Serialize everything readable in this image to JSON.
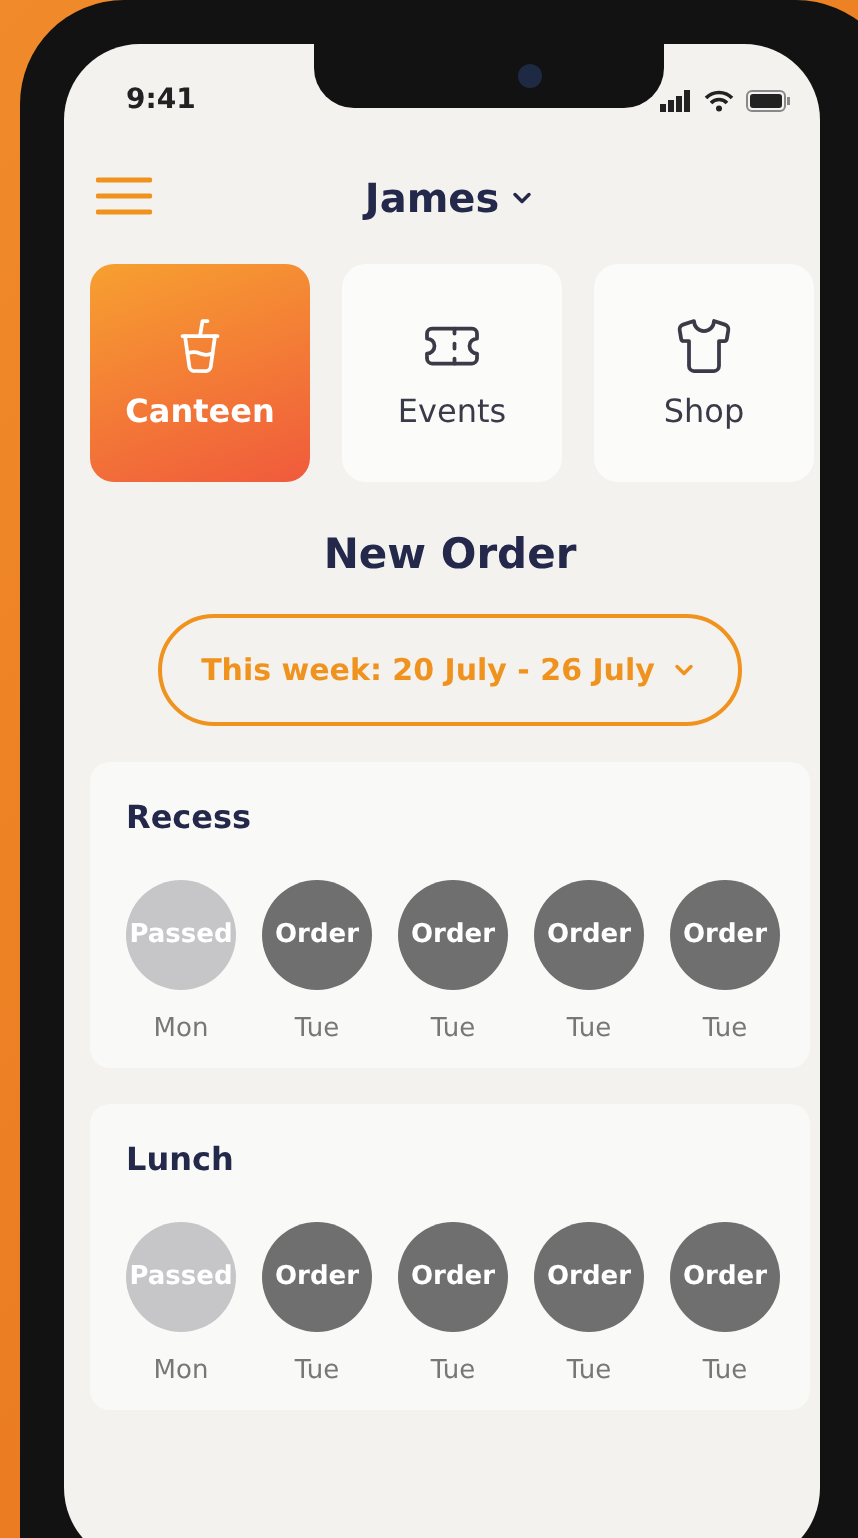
{
  "status_bar": {
    "time": "9:41"
  },
  "header": {
    "user": "James"
  },
  "categories": [
    {
      "label": "Canteen",
      "kind": "canteen",
      "selected": true
    },
    {
      "label": "Events",
      "kind": "events",
      "selected": false
    },
    {
      "label": "Shop",
      "kind": "shop",
      "selected": false
    }
  ],
  "title": "New Order",
  "week_selector": {
    "label": "This week: 20 July - 26 July"
  },
  "meals": [
    {
      "name": "Recess",
      "days": [
        {
          "label": "Passed",
          "day": "Mon",
          "kind": "passed"
        },
        {
          "label": "Order",
          "day": "Tue",
          "kind": "order"
        },
        {
          "label": "Order",
          "day": "Tue",
          "kind": "order"
        },
        {
          "label": "Order",
          "day": "Tue",
          "kind": "order"
        },
        {
          "label": "Order",
          "day": "Tue",
          "kind": "order"
        }
      ]
    },
    {
      "name": "Lunch",
      "days": [
        {
          "label": "Passed",
          "day": "Mon",
          "kind": "passed"
        },
        {
          "label": "Order",
          "day": "Tue",
          "kind": "order"
        },
        {
          "label": "Order",
          "day": "Tue",
          "kind": "order"
        },
        {
          "label": "Order",
          "day": "Tue",
          "kind": "order"
        },
        {
          "label": "Order",
          "day": "Tue",
          "kind": "order"
        }
      ]
    }
  ]
}
